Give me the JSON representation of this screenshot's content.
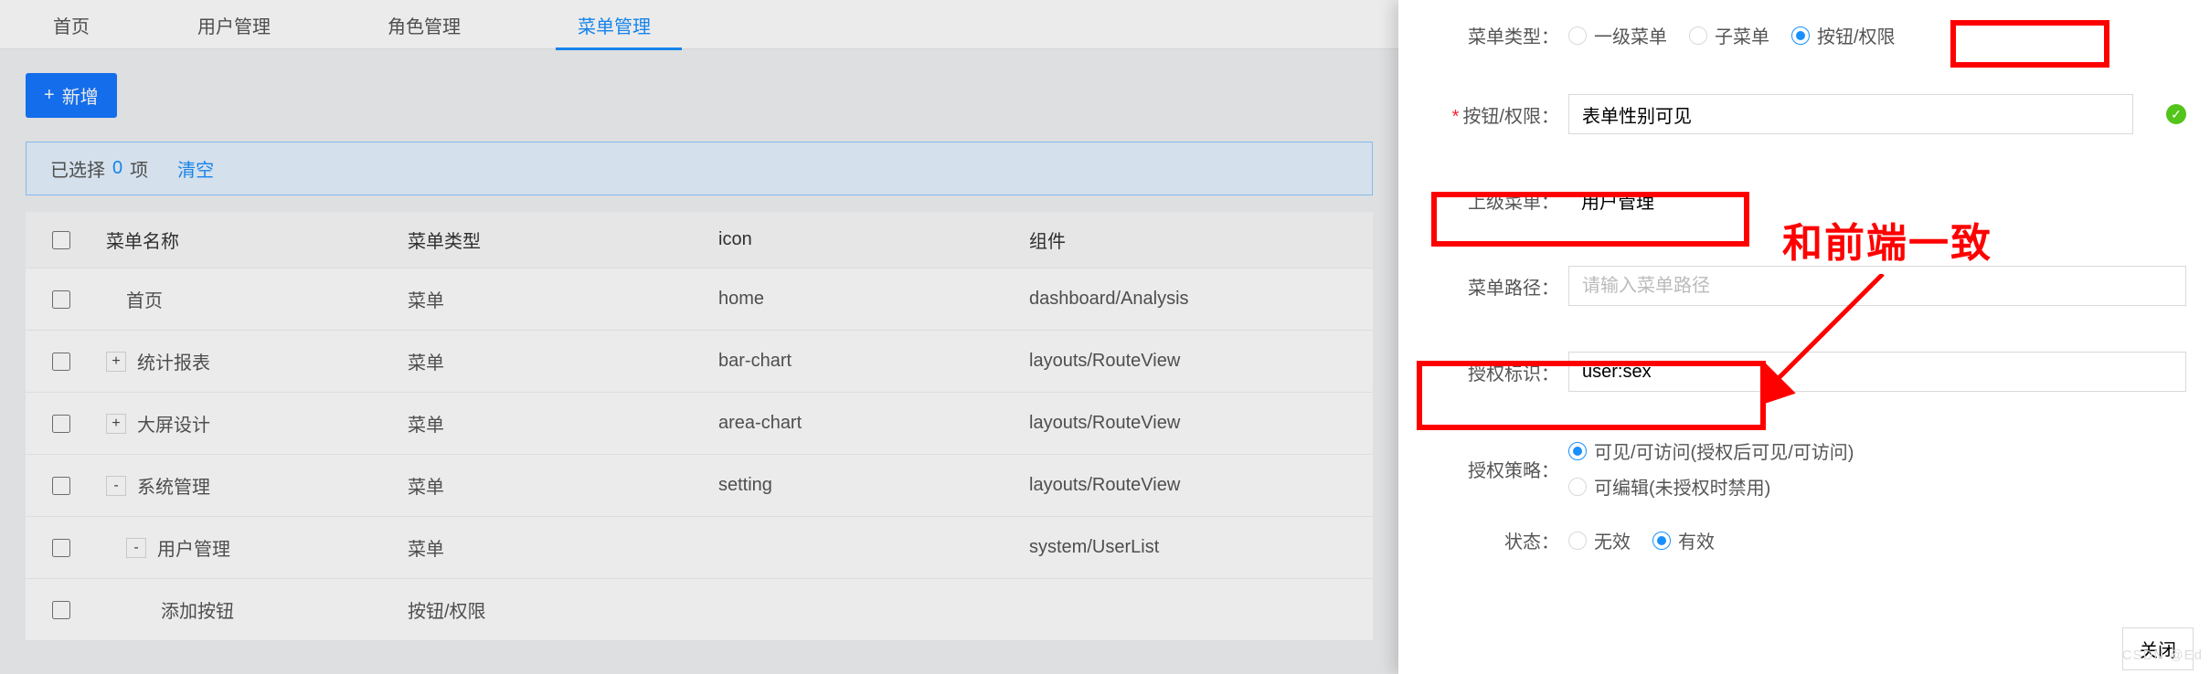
{
  "tabs": [
    "首页",
    "用户管理",
    "角色管理",
    "菜单管理"
  ],
  "active_tab_index": 3,
  "add_button": "新增",
  "selection_bar": {
    "prefix": "已选择",
    "count": "0",
    "suffix": "项",
    "clear": "清空"
  },
  "table": {
    "headers": [
      "菜单名称",
      "菜单类型",
      "icon",
      "组件"
    ],
    "rows": [
      {
        "name": "首页",
        "type": "菜单",
        "icon": "home",
        "comp": "dashboard/Analysis",
        "indent": 1,
        "expander": ""
      },
      {
        "name": "统计报表",
        "type": "菜单",
        "icon": "bar-chart",
        "comp": "layouts/RouteView",
        "indent": 0,
        "expander": "+"
      },
      {
        "name": "大屏设计",
        "type": "菜单",
        "icon": "area-chart",
        "comp": "layouts/RouteView",
        "indent": 0,
        "expander": "+"
      },
      {
        "name": "系统管理",
        "type": "菜单",
        "icon": "setting",
        "comp": "layouts/RouteView",
        "indent": 0,
        "expander": "-"
      },
      {
        "name": "用户管理",
        "type": "菜单",
        "icon": "",
        "comp": "system/UserList",
        "indent": 1,
        "expander": "-"
      },
      {
        "name": "添加按钮",
        "type": "按钮/权限",
        "icon": "",
        "comp": "",
        "indent": 2,
        "expander": ""
      }
    ]
  },
  "form": {
    "menu_type_label": "菜单类型：",
    "menu_type_options": [
      "一级菜单",
      "子菜单",
      "按钮/权限"
    ],
    "menu_type_selected": 2,
    "perm_label": "按钮/权限：",
    "perm_value": "表单性别可见",
    "parent_label": "上级菜单：",
    "parent_value": "用户管理",
    "path_label": "菜单路径：",
    "path_placeholder": "请输入菜单路径",
    "auth_id_label": "授权标识：",
    "auth_id_value": "user:sex",
    "policy_label": "授权策略：",
    "policy_options": [
      "可见/可访问(授权后可见/可访问)",
      "可编辑(未授权时禁用)"
    ],
    "policy_selected": 0,
    "status_label": "状态：",
    "status_options": [
      "无效",
      "有效"
    ],
    "status_selected": 1
  },
  "annotation": "和前端一致",
  "close_button": "关闭",
  "watermark": "CSDN @Ed"
}
